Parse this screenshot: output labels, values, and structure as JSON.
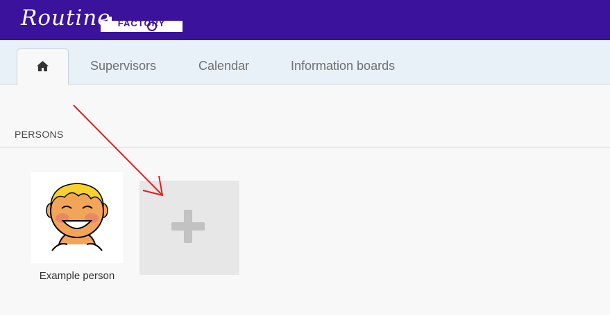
{
  "app": {
    "logo_script": "Routine",
    "logo_factory": "FACTORY"
  },
  "nav": {
    "tabs": [
      {
        "label": "",
        "icon": "home-icon",
        "active": true
      },
      {
        "label": "Supervisors",
        "active": false
      },
      {
        "label": "Calendar",
        "active": false
      },
      {
        "label": "Information boards",
        "active": false
      }
    ]
  },
  "persons": {
    "section_title": "PERSONS",
    "items": [
      {
        "name": "Example person",
        "avatar": "smiling-boy-avatar"
      }
    ],
    "add_button": {
      "icon": "plus-icon"
    }
  },
  "colors": {
    "topbar": "#3a129c",
    "navbar": "#e9f1f8",
    "annotation_arrow": "#e01e1e"
  }
}
